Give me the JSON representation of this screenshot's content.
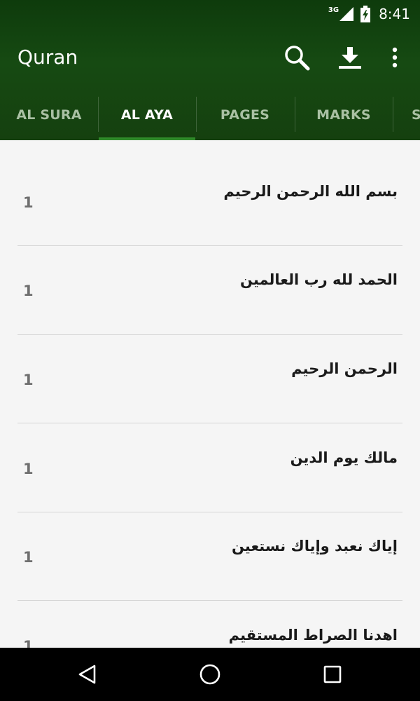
{
  "status_bar": {
    "network_type": "3G",
    "time": "8:41",
    "icons": [
      "signal-icon",
      "battery-icon"
    ]
  },
  "app_bar": {
    "title": "Quran",
    "actions": [
      "search-icon",
      "download-icon",
      "more-vert-icon"
    ]
  },
  "tabs": [
    {
      "label": "AL SURA",
      "selected": false
    },
    {
      "label": "AL AYA",
      "selected": true
    },
    {
      "label": "PAGES",
      "selected": false
    },
    {
      "label": "MARKS",
      "selected": false
    },
    {
      "label": "S",
      "selected": false
    }
  ],
  "verses": [
    {
      "text": "بسم الله الرحمن الرحيم",
      "sura": "1"
    },
    {
      "text": "الحمد لله رب العالمين",
      "sura": "1"
    },
    {
      "text": "الرحمن الرحيم",
      "sura": "1"
    },
    {
      "text": "مالك يوم الدين",
      "sura": "1"
    },
    {
      "text": "إياك نعبد وإياك نستعين",
      "sura": "1"
    },
    {
      "text": "اهدنا الصراط المستقيم",
      "sura": "1"
    }
  ],
  "nav_bar": {
    "icons": [
      "back-icon",
      "home-icon",
      "recents-icon"
    ]
  },
  "colors": {
    "header_bg": "#164a12",
    "tab_indicator": "#2f8a2a",
    "tab_inactive_text": "#a9c0a3",
    "list_bg": "#f5f5f5",
    "divider": "#d5d5d5"
  }
}
